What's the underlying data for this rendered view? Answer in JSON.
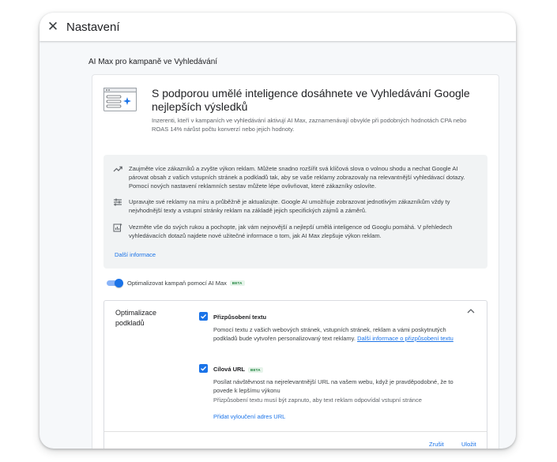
{
  "window": {
    "title": "Nastavení",
    "close_icon": "close-icon"
  },
  "section": {
    "heading": "AI Max pro kampaně ve Vyhledávání"
  },
  "hero": {
    "title": "S podporou umělé inteligence dosáhnete ve Vyhledávání Google nejlepších výsledků",
    "subtitle": "Inzerenti, kteří v kampaních ve vyhledávání aktivují AI Max, zaznamenávají obvykle při podobných hodnotách CPA nebo ROAS 14% nárůst počtu konverzí nebo jejich hodnoty."
  },
  "info": {
    "items": [
      {
        "icon": "trending-up-icon",
        "text": "Zaujměte více zákazníků a zvyšte výkon reklam. Můžete snadno rozšířit svá klíčová slova o volnou shodu a nechat Google AI párovat obsah z vašich vstupních stránek a podkladů tak, aby se vaše reklamy zobrazovaly na relevantnější vyhledávací dotazy. Pomocí nových nastavení reklamních sestav můžete lépe ovlivňovat, které zákazníky oslovíte."
      },
      {
        "icon": "tune-icon",
        "text": "Upravujte své reklamy na míru a průběžně je aktualizujte. Google AI umožňuje zobrazovat jednotlivým zákazníkům vždy ty nejvhodnější texty a vstupní stránky reklam na základě jejich specifických zájmů a záměrů."
      },
      {
        "icon": "insights-icon",
        "text": "Vezměte vše do svých rukou a pochopte, jak vám nejnovější a nejlepší umělá inteligence od Googlu pomáhá. V přehledech vyhledávacích dotazů najdete nové užitečné informace o tom, jak AI Max zlepšuje výkon reklam."
      }
    ],
    "more_link": "Další informace"
  },
  "toggle": {
    "label": "Optimalizovat kampaň pomocí AI Max",
    "badge": "BETA",
    "on": true
  },
  "optimization": {
    "label": "Optimalizace podkladů",
    "text_custom": {
      "label": "Přizpůsobení textu",
      "description": "Pomocí textu z vašich webových stránek, vstupních stránek, reklam a vámi poskytnutých podkladů bude vytvořen personalizovaný text reklamy.",
      "link": "Další informace o přizpůsobení textu",
      "checked": true
    },
    "final_url": {
      "label": "Cílová URL",
      "badge": "BETA",
      "description": "Posílat návštěvnost na nejrelevantnější URL na vašem webu, když je pravděpodobné, že to povede k lepšímu výkonu",
      "note": "Přizpůsobení textu musí být zapnuto, aby text reklam odpovídal vstupní stránce",
      "add_exclusion": "Přidat vyloučení adres URL",
      "checked": true
    },
    "cancel": "Zrušit",
    "save": "Uložit"
  },
  "colors": {
    "accent": "#1a73e8",
    "beta_text": "#188038",
    "beta_bg": "#e6f4ea",
    "panel_bg": "#f1f3f4"
  }
}
